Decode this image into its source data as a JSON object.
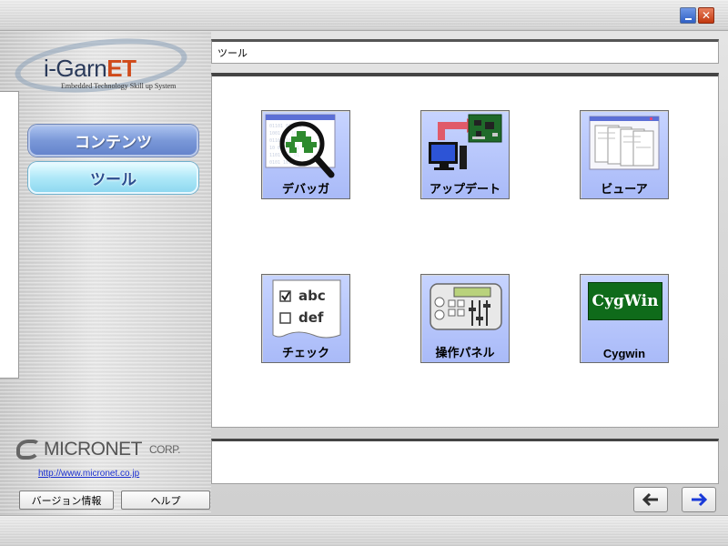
{
  "window": {
    "minimize_icon": "minimize-icon",
    "close_icon": "close-icon"
  },
  "logo": {
    "name_main": "i-Garn",
    "name_accent": "ET",
    "tagline": "Embedded Technology Skill up System"
  },
  "nav": {
    "contents_label": "コンテンツ",
    "tools_label": "ツール"
  },
  "path_bar": {
    "text": "ツール"
  },
  "tools": [
    {
      "label": "デバッガ",
      "icon": "debugger-magnifier-icon"
    },
    {
      "label": "アップデート",
      "icon": "update-pc-board-icon"
    },
    {
      "label": "ビューア",
      "icon": "viewer-documents-icon"
    },
    {
      "label": "チェック",
      "icon": "check-list-icon",
      "check_items": [
        "abc",
        "def"
      ]
    },
    {
      "label": "操作パネル",
      "icon": "operation-panel-icon"
    },
    {
      "label": "Cygwin",
      "icon": "cygwin-logo-icon",
      "logo_text": "CygWin"
    }
  ],
  "footer": {
    "company_name": "MICRONET",
    "company_suffix": "CORP.",
    "url": "http://www.micronet.co.jp",
    "version_button": "バージョン情報",
    "help_button": "ヘルプ",
    "back_icon": "arrow-left-icon",
    "forward_icon": "arrow-right-icon"
  },
  "colors": {
    "accent_blue": "#2a4d8f",
    "tile_blue": "#a9baf8",
    "logo_accent": "#d04a1a",
    "cygwin_green": "#0f6b1a"
  }
}
